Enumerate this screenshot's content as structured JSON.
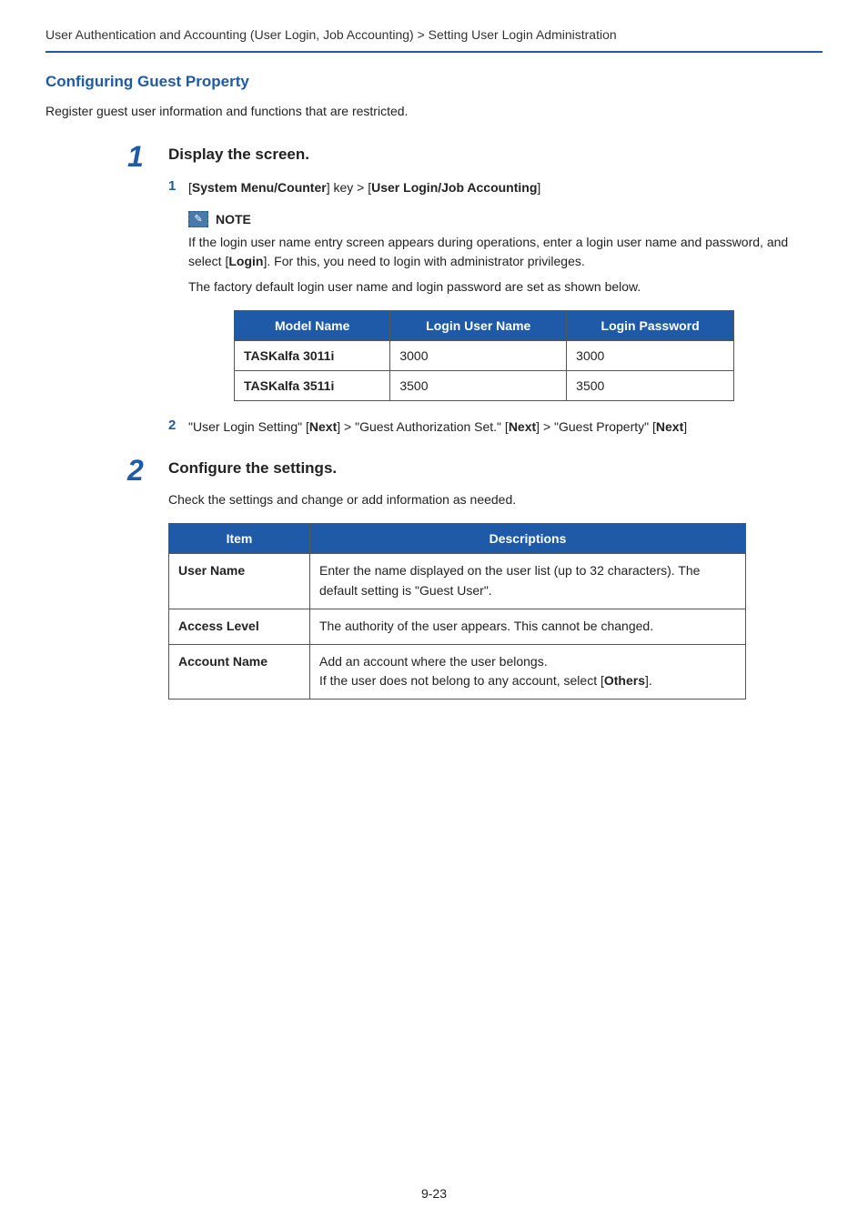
{
  "breadcrumb": "User Authentication and Accounting (User Login, Job Accounting) > Setting User Login Administration",
  "section_title": "Configuring Guest Property",
  "intro": "Register guest user information and functions that are restricted.",
  "step1": {
    "num": "1",
    "heading": "Display the screen.",
    "sub1": {
      "num": "1",
      "pre": "[",
      "k1": "System Menu/Counter",
      "mid": "] key > [",
      "k2": "User Login/Job Accounting",
      "post": "]"
    },
    "note": {
      "label": "NOTE",
      "l1a": "If the login user name entry screen appears during operations, enter a login user name and password, and select [",
      "l1b": "Login",
      "l1c": "]. For this, you need to login with administrator privileges.",
      "l2": "The factory default login user name and login password are set as shown below."
    },
    "login_table": {
      "headers": [
        "Model Name",
        "Login User Name",
        "Login Password"
      ],
      "rows": [
        [
          "TASKalfa 3011i",
          "3000",
          "3000"
        ],
        [
          "TASKalfa 3511i",
          "3500",
          "3500"
        ]
      ]
    },
    "sub2": {
      "num": "2",
      "t1": "\"User Login Setting\" [",
      "b1": "Next",
      "t2": "] > \"Guest Authorization Set.\" [",
      "b2": "Next",
      "t3": "] > \"Guest Property\" [",
      "b3": "Next",
      "t4": "]"
    }
  },
  "step2": {
    "num": "2",
    "heading": "Configure the settings.",
    "text": "Check the settings and change or add information as needed.",
    "settings_table": {
      "headers": [
        "Item",
        "Descriptions"
      ],
      "rows": [
        {
          "item": "User Name",
          "desc": "Enter the name displayed on the user list (up to 32 characters). The default setting is \"Guest User\"."
        },
        {
          "item": "Access Level",
          "desc": "The authority of the user appears. This cannot be changed."
        },
        {
          "item": "Account Name",
          "desc_a": "Add an account where the user belongs.",
          "desc_b1": "If the user does not belong to any account, select [",
          "desc_b2": "Others",
          "desc_b3": "]."
        }
      ]
    }
  },
  "page_num": "9-23"
}
